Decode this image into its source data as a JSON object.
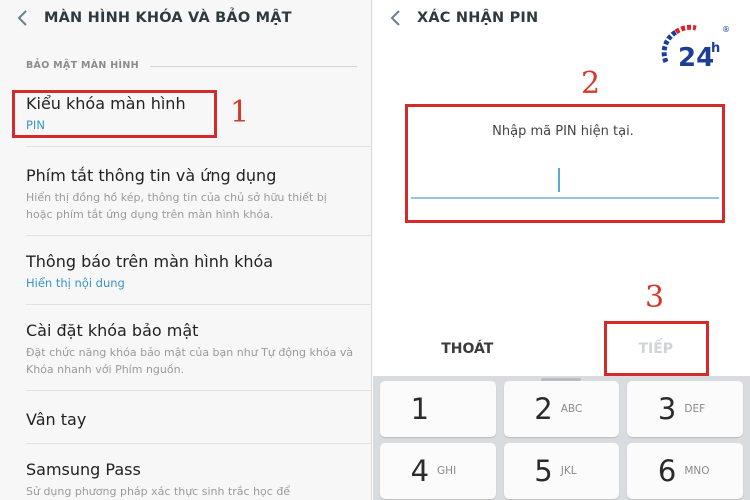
{
  "left_screen": {
    "title": "MÀN HÌNH KHÓA VÀ BẢO MẬT",
    "section": "BẢO MẬT MÀN HÌNH",
    "items": [
      {
        "title": "Kiểu khóa màn hình",
        "subtitle": "PIN"
      },
      {
        "title": "Phím tắt thông tin và ứng dụng",
        "description": "Hiển thị đồng hồ kép, thông tin của chủ sở hữu thiết bị hoặc phím tắt ứng dụng trên màn hình khóa."
      },
      {
        "title": "Thông báo trên màn hình khóa",
        "subtitle": "Hiển thị nội dung"
      },
      {
        "title": "Cài đặt khóa bảo mật",
        "description": "Đặt chức năng khóa bảo mật của bạn như Tự động khóa và Khóa nhanh với Phím nguồn."
      },
      {
        "title": "Vân tay"
      },
      {
        "title": "Samsung Pass",
        "description": "Sử dụng phương pháp xác thực sinh trắc học để"
      }
    ]
  },
  "right_screen": {
    "title": "XÁC NHẬN PIN",
    "prompt": "Nhập mã PIN hiện tại.",
    "pin_value": "",
    "exit_label": "THOÁT",
    "next_label": "TIẾP",
    "keys": [
      {
        "num": "1",
        "letters": ""
      },
      {
        "num": "2",
        "letters": "ABC"
      },
      {
        "num": "3",
        "letters": "DEF"
      },
      {
        "num": "4",
        "letters": "GHI"
      },
      {
        "num": "5",
        "letters": "JKL"
      },
      {
        "num": "6",
        "letters": "MNO"
      }
    ]
  },
  "annotations": {
    "step1": "1",
    "step2": "2",
    "step3": "3"
  },
  "logo": {
    "text": "24",
    "superscript": "h",
    "registered": "®"
  },
  "colors": {
    "highlight": "#d42a2a",
    "accent": "#3a93c9",
    "step_number": "#d23a2a",
    "logo_blue": "#1c3f95",
    "logo_red": "#d8232a"
  }
}
